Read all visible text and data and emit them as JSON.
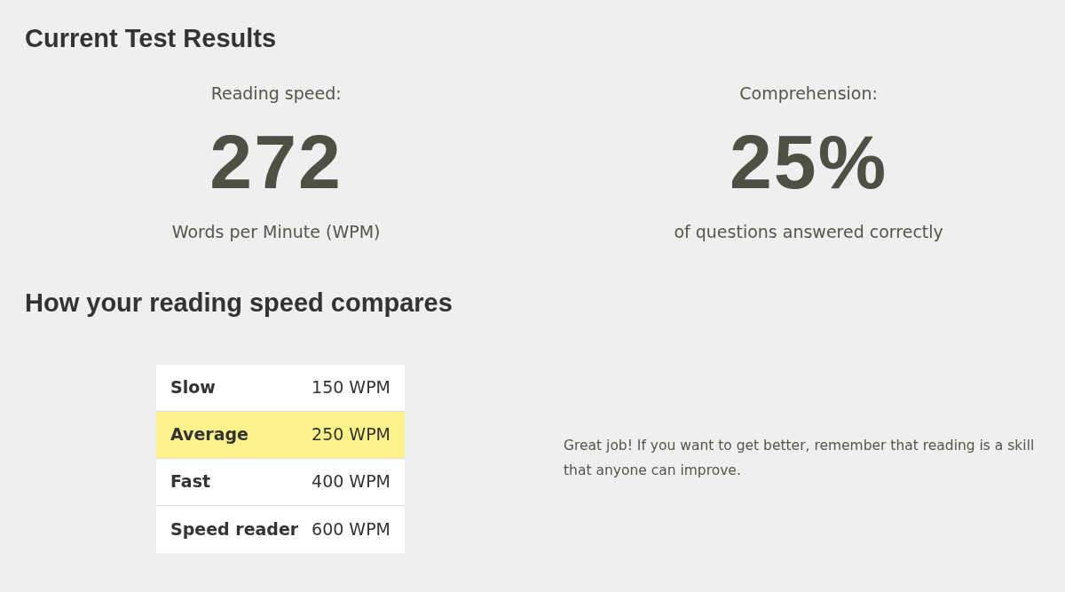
{
  "results_heading": "Current Test Results",
  "metrics": [
    {
      "label": "Reading speed:",
      "value": "272",
      "caption": "Words per Minute (WPM)"
    },
    {
      "label": "Comprehension:",
      "value": "25%",
      "caption": "of questions answered correctly"
    }
  ],
  "compare_heading": "How your reading speed compares",
  "speed_table": {
    "rows": [
      {
        "category": "Slow",
        "speed": "150 WPM",
        "selected": false
      },
      {
        "category": "Average",
        "speed": "250 WPM",
        "selected": true
      },
      {
        "category": "Fast",
        "speed": "400 WPM",
        "selected": false
      },
      {
        "category": "Speed reader",
        "speed": "600 WPM",
        "selected": false
      }
    ]
  },
  "feedback": "Great job! If you want to get better, remember that reading is a skill that anyone can improve."
}
